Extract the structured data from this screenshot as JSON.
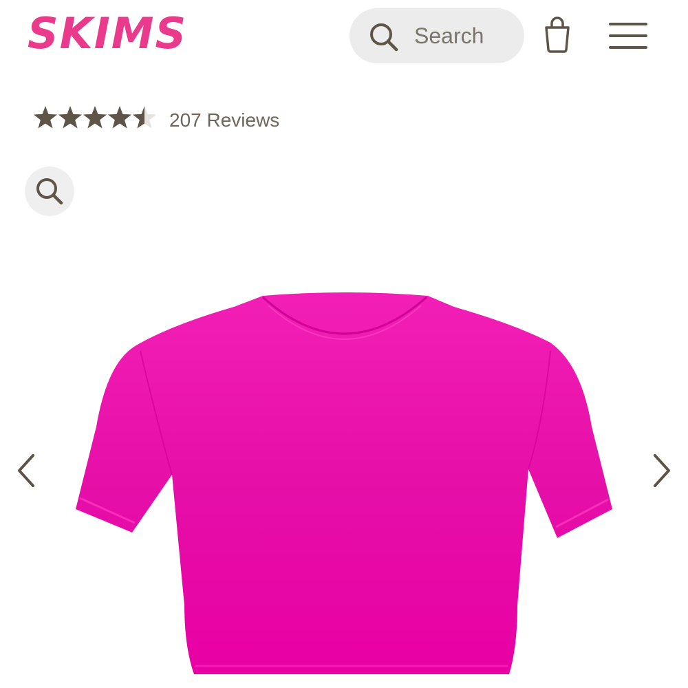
{
  "header": {
    "logo_text": "SKIMS",
    "search_placeholder": "Search",
    "bag_icon": "shopping-bag-icon",
    "menu_icon": "hamburger-menu-icon"
  },
  "rating": {
    "stars": 4.5,
    "max_stars": 5,
    "review_count_label": "207 Reviews"
  },
  "gallery": {
    "zoom_icon": "magnifier-icon",
    "prev_icon": "chevron-left-icon",
    "next_icon": "chevron-right-icon",
    "product_image": "pink cropped t-shirt"
  },
  "colors": {
    "brand_pink": "#ea3a8c",
    "icon_brown": "#5e5548",
    "product_magenta": "#e8009a"
  }
}
